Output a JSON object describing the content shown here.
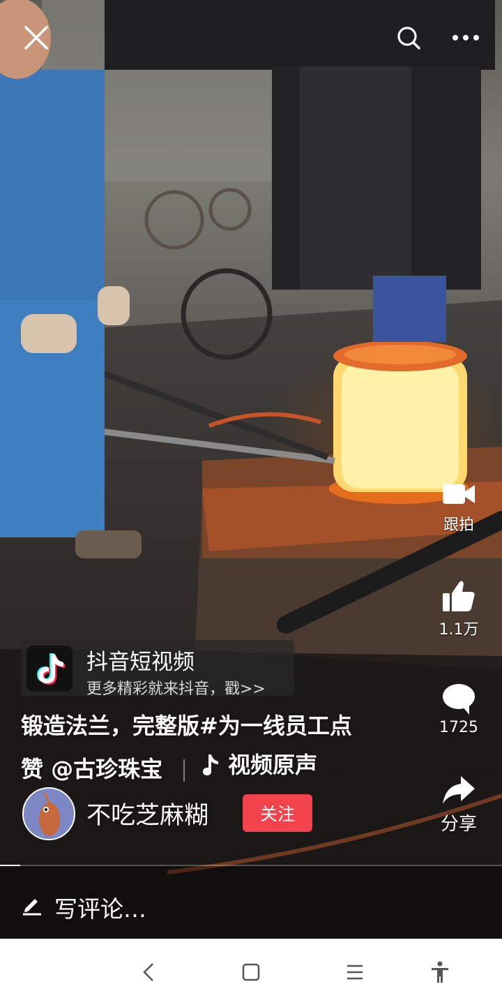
{
  "top_bar": {
    "close_icon": "close-icon",
    "search_icon": "search-icon",
    "more_icon": "more-icon"
  },
  "right_rail": {
    "duet_label": "跟拍",
    "likes_count": "1.1万",
    "comments_count": "1725",
    "share_label": "分享"
  },
  "promo": {
    "title": "抖音短视频",
    "subtitle": "更多精彩就来抖音，戳>>"
  },
  "caption": {
    "line1": "锻造法兰，完整版#为一线员工点",
    "line2_prefix": "赞 @古珍珠宝",
    "music": "视频原声"
  },
  "author": {
    "name": "不吃芝麻糊",
    "follow_label": "关注"
  },
  "video_progress": 0.04,
  "comment_bar": {
    "placeholder": "写评论…"
  },
  "system_nav": {
    "back_icon": "back-icon",
    "home_icon": "home-icon",
    "menu_icon": "menu-icon",
    "accessibility_icon": "accessibility-icon"
  },
  "colors": {
    "follow_button": "#f2434d",
    "background": "#111111",
    "nav_background": "#ffffff"
  }
}
